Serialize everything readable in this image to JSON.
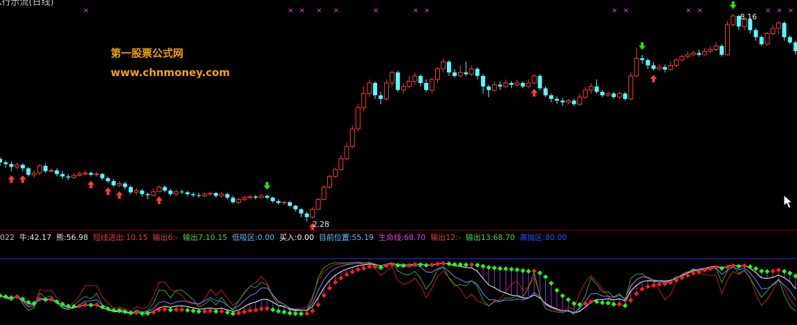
{
  "window": {
    "title": "K行示流(日线)"
  },
  "watermark": {
    "line1": "第一股票公式网",
    "line2": "www.chnmoney.com"
  },
  "indicator_bar": [
    {
      "text": "022",
      "color": "#c8c8c8"
    },
    {
      "text": "牛:42.17",
      "color": "#e8e8e8"
    },
    {
      "text": "熊:56.98",
      "color": "#e8e8e8"
    },
    {
      "text": "短线进出:10.15",
      "color": "#e04040"
    },
    {
      "text": "输出6:-",
      "color": "#e04040"
    },
    {
      "text": "输出7:10.15",
      "color": "#50d050"
    },
    {
      "text": "低吸区:0.00",
      "color": "#60c0ff"
    },
    {
      "text": "买入:0.00",
      "color": "#ffffff"
    },
    {
      "text": "目前位置:55.19",
      "color": "#60c0ff"
    },
    {
      "text": "生命线:68.70",
      "color": "#e040e0"
    },
    {
      "text": "输出12:-",
      "color": "#e04040"
    },
    {
      "text": "输出13:68.70",
      "color": "#50d050"
    },
    {
      "text": "高抛区:80.00",
      "color": "#3050ff"
    }
  ],
  "colors": {
    "up": "#ff3c3c",
    "down": "#54ffff",
    "buy_arrow": "#ff3c3c",
    "sell_arrow": "#20e020",
    "x_marker": "#ff40ff",
    "separator": "#a00000",
    "level_line": "#3030ff",
    "dot_red": "#ff2020",
    "dot_green": "#20ff20",
    "hatch": "#c040ff"
  },
  "chart_data": {
    "type": "candlestick",
    "y_labels": [
      {
        "text": "8.16",
        "at": 8.16
      },
      {
        "text": "2.28",
        "at": 2.28
      }
    ],
    "candles": [
      [
        4.05,
        3.95,
        4.1,
        3.85
      ],
      [
        3.95,
        3.9,
        4.0,
        3.8
      ],
      [
        3.9,
        3.82,
        3.98,
        3.7
      ],
      [
        3.82,
        3.88,
        3.95,
        3.75
      ],
      [
        3.88,
        3.78,
        3.92,
        3.7
      ],
      [
        3.78,
        3.6,
        3.82,
        3.55
      ],
      [
        3.6,
        3.65,
        3.72,
        3.52
      ],
      [
        3.65,
        3.85,
        3.9,
        3.6
      ],
      [
        3.85,
        3.7,
        3.92,
        3.65
      ],
      [
        3.7,
        3.72,
        3.8,
        3.65
      ],
      [
        3.72,
        3.62,
        3.78,
        3.55
      ],
      [
        3.62,
        3.55,
        3.7,
        3.48
      ],
      [
        3.55,
        3.52,
        3.62,
        3.45
      ],
      [
        3.52,
        3.58,
        3.65,
        3.48
      ],
      [
        3.58,
        3.62,
        3.7,
        3.55
      ],
      [
        3.62,
        3.65,
        3.72,
        3.58
      ],
      [
        3.65,
        3.6,
        3.7,
        3.55
      ],
      [
        3.6,
        3.62,
        3.68,
        3.55
      ],
      [
        3.62,
        3.5,
        3.65,
        3.45
      ],
      [
        3.5,
        3.42,
        3.55,
        3.36
      ],
      [
        3.42,
        3.3,
        3.48,
        3.25
      ],
      [
        3.3,
        3.35,
        3.42,
        3.25
      ],
      [
        3.35,
        3.25,
        3.4,
        3.18
      ],
      [
        3.25,
        3.1,
        3.3,
        3.05
      ],
      [
        3.1,
        3.15,
        3.22,
        3.02
      ],
      [
        3.15,
        3.05,
        3.2,
        2.98
      ],
      [
        3.05,
        3.02,
        3.1,
        2.9
      ],
      [
        3.02,
        3.12,
        3.2,
        2.98
      ],
      [
        3.12,
        3.25,
        3.3,
        3.1
      ],
      [
        3.25,
        3.15,
        3.3,
        3.1
      ],
      [
        3.15,
        3.05,
        3.2,
        3.0
      ],
      [
        3.05,
        3.12,
        3.18,
        3.0
      ],
      [
        3.12,
        3.1,
        3.18,
        3.05
      ],
      [
        3.1,
        3.05,
        3.14,
        3.0
      ],
      [
        3.05,
        3.02,
        3.1,
        2.96
      ],
      [
        3.02,
        3.0,
        3.08,
        2.95
      ],
      [
        3.0,
        3.05,
        3.1,
        2.96
      ],
      [
        3.05,
        3.08,
        3.12,
        3.0
      ],
      [
        3.08,
        3.0,
        3.12,
        2.95
      ],
      [
        3.0,
        3.05,
        3.1,
        2.96
      ],
      [
        3.05,
        2.95,
        3.08,
        2.9
      ],
      [
        2.95,
        2.82,
        3.0,
        2.78
      ],
      [
        2.82,
        2.9,
        2.95,
        2.76
      ],
      [
        2.9,
        2.95,
        3.0,
        2.85
      ],
      [
        2.95,
        2.98,
        3.04,
        2.9
      ],
      [
        2.98,
        2.95,
        3.02,
        2.9
      ],
      [
        2.95,
        3.0,
        3.05,
        2.92
      ],
      [
        3.0,
        2.95,
        3.04,
        2.9
      ],
      [
        2.95,
        2.85,
        2.98,
        2.8
      ],
      [
        2.85,
        2.8,
        2.9,
        2.75
      ],
      [
        2.8,
        2.82,
        2.86,
        2.75
      ],
      [
        2.82,
        2.72,
        2.86,
        2.68
      ],
      [
        2.72,
        2.62,
        2.75,
        2.55
      ],
      [
        2.62,
        2.5,
        2.65,
        2.4
      ],
      [
        2.5,
        2.4,
        2.55,
        2.28
      ],
      [
        2.4,
        2.62,
        2.68,
        2.35
      ],
      [
        2.62,
        2.9,
        2.95,
        2.6
      ],
      [
        2.9,
        3.25,
        3.3,
        2.88
      ],
      [
        3.25,
        3.55,
        3.6,
        3.2
      ],
      [
        3.55,
        3.75,
        3.8,
        3.5
      ],
      [
        3.75,
        4.05,
        4.15,
        3.72
      ],
      [
        4.05,
        4.4,
        4.5,
        4.0
      ],
      [
        4.4,
        4.9,
        5.0,
        4.35
      ],
      [
        4.9,
        5.5,
        5.6,
        4.85
      ],
      [
        5.5,
        5.9,
        6.1,
        5.4
      ],
      [
        5.9,
        6.2,
        6.3,
        5.8
      ],
      [
        6.2,
        5.85,
        6.25,
        5.75
      ],
      [
        5.85,
        5.75,
        5.95,
        5.6
      ],
      [
        5.75,
        6.2,
        6.3,
        5.7
      ],
      [
        6.2,
        6.5,
        6.55,
        6.1
      ],
      [
        6.5,
        6.0,
        6.55,
        5.95
      ],
      [
        6.0,
        6.1,
        6.2,
        5.9
      ],
      [
        6.1,
        6.25,
        6.4,
        6.05
      ],
      [
        6.25,
        6.4,
        6.5,
        6.15
      ],
      [
        6.4,
        6.2,
        6.45,
        6.1
      ],
      [
        6.2,
        6.0,
        6.3,
        5.95
      ],
      [
        6.0,
        6.3,
        6.35,
        5.9
      ],
      [
        6.3,
        6.6,
        6.65,
        6.2
      ],
      [
        6.6,
        6.8,
        6.9,
        6.5
      ],
      [
        6.8,
        6.5,
        6.85,
        6.4
      ],
      [
        6.5,
        6.4,
        6.6,
        6.35
      ],
      [
        6.4,
        6.5,
        6.7,
        6.35
      ],
      [
        6.5,
        6.45,
        6.8,
        6.4
      ],
      [
        6.45,
        6.6,
        6.7,
        6.4
      ],
      [
        6.6,
        6.4,
        6.65,
        6.3
      ],
      [
        6.4,
        6.1,
        6.45,
        5.9
      ],
      [
        6.1,
        6.0,
        6.15,
        5.8
      ],
      [
        6.0,
        6.15,
        6.25,
        5.95
      ],
      [
        6.15,
        6.1,
        6.25,
        6.0
      ],
      [
        6.1,
        6.2,
        6.3,
        6.05
      ],
      [
        6.2,
        6.15,
        6.25,
        6.05
      ],
      [
        6.15,
        6.2,
        6.3,
        6.1
      ],
      [
        6.2,
        6.1,
        6.25,
        6.05
      ],
      [
        6.1,
        6.2,
        6.3,
        6.05
      ],
      [
        6.2,
        6.4,
        6.45,
        6.15
      ],
      [
        6.4,
        6.05,
        6.45,
        6.0
      ],
      [
        6.05,
        5.85,
        6.1,
        5.8
      ],
      [
        5.85,
        5.75,
        5.9,
        5.65
      ],
      [
        5.75,
        5.7,
        5.82,
        5.6
      ],
      [
        5.7,
        5.65,
        5.78,
        5.55
      ],
      [
        5.65,
        5.7,
        5.75,
        5.6
      ],
      [
        5.7,
        5.6,
        5.75,
        5.55
      ],
      [
        5.6,
        5.8,
        5.9,
        5.55
      ],
      [
        5.8,
        6.0,
        6.1,
        5.75
      ],
      [
        6.0,
        6.1,
        6.2,
        5.9
      ],
      [
        6.1,
        5.95,
        6.3,
        5.9
      ],
      [
        5.95,
        5.85,
        6.0,
        5.8
      ],
      [
        5.85,
        5.9,
        5.95,
        5.8
      ],
      [
        5.9,
        5.8,
        5.95,
        5.75
      ],
      [
        5.8,
        5.9,
        5.95,
        5.75
      ],
      [
        5.9,
        5.75,
        5.95,
        5.7
      ],
      [
        5.75,
        6.4,
        6.5,
        5.7
      ],
      [
        6.4,
        6.9,
        7.2,
        6.35
      ],
      [
        6.9,
        6.85,
        7.0,
        6.75
      ],
      [
        6.85,
        6.7,
        6.9,
        6.6
      ],
      [
        6.7,
        6.6,
        6.8,
        6.55
      ],
      [
        6.6,
        6.65,
        6.75,
        6.55
      ],
      [
        6.65,
        6.58,
        6.72,
        6.5
      ],
      [
        6.58,
        6.7,
        6.8,
        6.55
      ],
      [
        6.7,
        6.85,
        6.9,
        6.65
      ],
      [
        6.85,
        6.95,
        7.0,
        6.8
      ],
      [
        6.95,
        7.0,
        7.1,
        6.9
      ],
      [
        7.0,
        7.05,
        7.12,
        6.95
      ],
      [
        7.05,
        7.0,
        7.15,
        6.95
      ],
      [
        7.0,
        7.1,
        7.2,
        6.98
      ],
      [
        7.1,
        7.15,
        7.25,
        7.05
      ],
      [
        7.15,
        7.25,
        7.35,
        7.1
      ],
      [
        7.25,
        7.0,
        7.3,
        6.95
      ],
      [
        7.0,
        7.85,
        7.95,
        6.98
      ],
      [
        7.85,
        8.1,
        8.16,
        7.8
      ],
      [
        8.1,
        7.8,
        8.12,
        7.7
      ],
      [
        7.8,
        8.0,
        8.05,
        7.7
      ],
      [
        8.0,
        7.7,
        8.05,
        7.6
      ],
      [
        7.7,
        7.5,
        7.75,
        7.4
      ],
      [
        7.5,
        7.3,
        7.55,
        7.25
      ],
      [
        7.3,
        7.6,
        7.65,
        7.25
      ],
      [
        7.6,
        7.75,
        7.85,
        7.55
      ],
      [
        7.75,
        7.9,
        7.95,
        7.6
      ],
      [
        7.9,
        7.5,
        7.95,
        7.4
      ],
      [
        7.5,
        7.35,
        7.55,
        7.3
      ],
      [
        7.35,
        7.1,
        7.4,
        7.0
      ]
    ],
    "buy_arrows": [
      2,
      4,
      16,
      19,
      21,
      28,
      55,
      94,
      115
    ],
    "sell_arrows": [
      47,
      113,
      129
    ],
    "x_markers": [
      15,
      51,
      53,
      56,
      59,
      66,
      73,
      75,
      108,
      110,
      121,
      123,
      135,
      137,
      139
    ]
  }
}
